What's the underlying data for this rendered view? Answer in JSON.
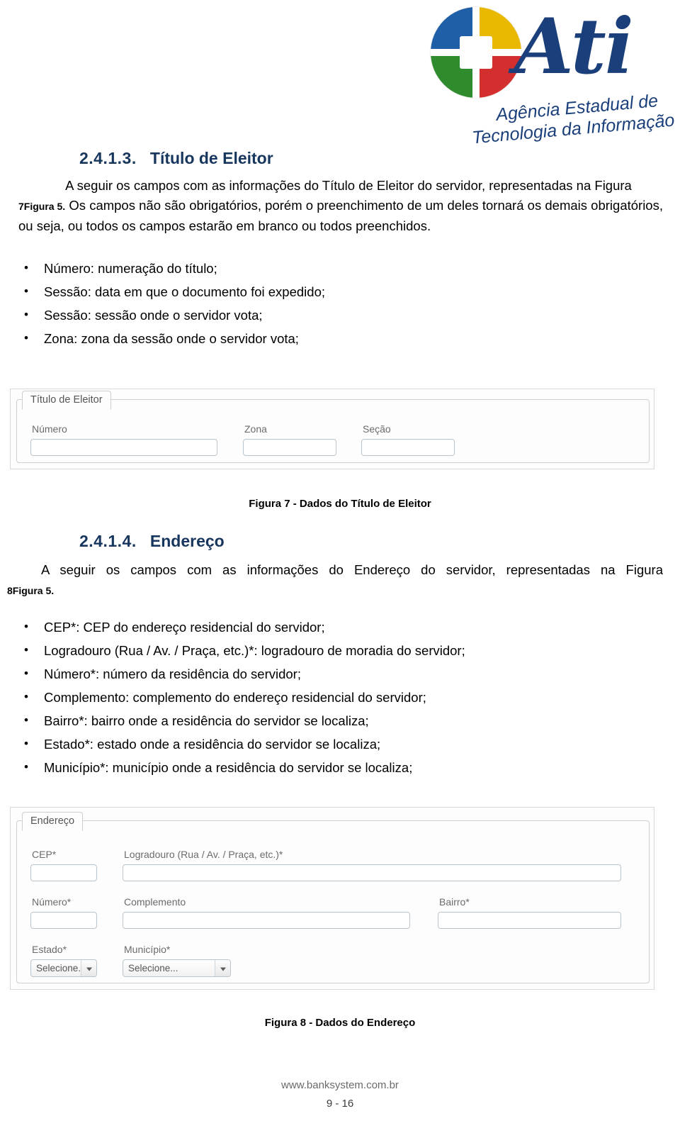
{
  "logo": {
    "wordmark": "Ati",
    "line1": "Agência Estadual de",
    "line2": "Tecnologia da Informação",
    "colors": {
      "blue": "#1f5fa8",
      "red": "#d32f2f",
      "green": "#2e8b2e",
      "yellow": "#e8b900",
      "text_blue": "#1b3f7a"
    }
  },
  "section1": {
    "number": "2.4.1.3.",
    "title": "Título de Eleitor",
    "paragraph_line1": "A seguir os campos com as informações do Título de Eleitor do servidor, representadas na Figura",
    "paragraph_figure_num": "7",
    "paragraph_figure_ref": "Figura 5.",
    "paragraph_rest": "Os campos não são obrigatórios, porém o preenchimento de um deles tornará os demais obrigatórios, ou seja, ou todos os campos estarão em branco ou todos preenchidos.",
    "bullets": [
      "Número: numeração do título;",
      "Sessão: data em que o documento foi expedido;",
      "Sessão: sessão onde o servidor vota;",
      "Zona: zona da sessão onde o servidor vota;"
    ]
  },
  "figure7": {
    "legend": "Título de Eleitor",
    "fields": [
      {
        "label": "Número",
        "value": ""
      },
      {
        "label": "Zona",
        "value": ""
      },
      {
        "label": "Seção",
        "value": ""
      }
    ],
    "caption": "Figura 7 - Dados do Título de Eleitor"
  },
  "section2": {
    "number": "2.4.1.4.",
    "title": "Endereço",
    "paragraph_line1": "A seguir os campos com as informações do Endereço do servidor, representadas na Figura",
    "paragraph_figure_num": "8",
    "paragraph_figure_ref": "Figura 5.",
    "bullets": [
      "CEP*: CEP do endereço residencial do servidor;",
      "Logradouro (Rua / Av. / Praça, etc.)*: logradouro de moradia do servidor;",
      "Número*: número da residência do servidor;",
      "Complemento: complemento do endereço residencial do servidor;",
      "Bairro*: bairro onde a residência do servidor se localiza;",
      "Estado*: estado onde a residência do servidor se localiza;",
      "Município*: município onde a residência do servidor se localiza;"
    ]
  },
  "figure8": {
    "legend": "Endereço",
    "fields": [
      {
        "label": "CEP*",
        "value": ""
      },
      {
        "label": "Logradouro (Rua / Av. / Praça, etc.)*",
        "value": ""
      },
      {
        "label": "Número*",
        "value": ""
      },
      {
        "label": "Complemento",
        "value": ""
      },
      {
        "label": "Bairro*",
        "value": ""
      }
    ],
    "selects": [
      {
        "label": "Estado*",
        "value": "Selecione.."
      },
      {
        "label": "Município*",
        "value": "Selecione..."
      }
    ],
    "caption": "Figura 8 - Dados do Endereço"
  },
  "footer": {
    "url": "www.banksystem.com.br",
    "page": "9 - 16"
  }
}
